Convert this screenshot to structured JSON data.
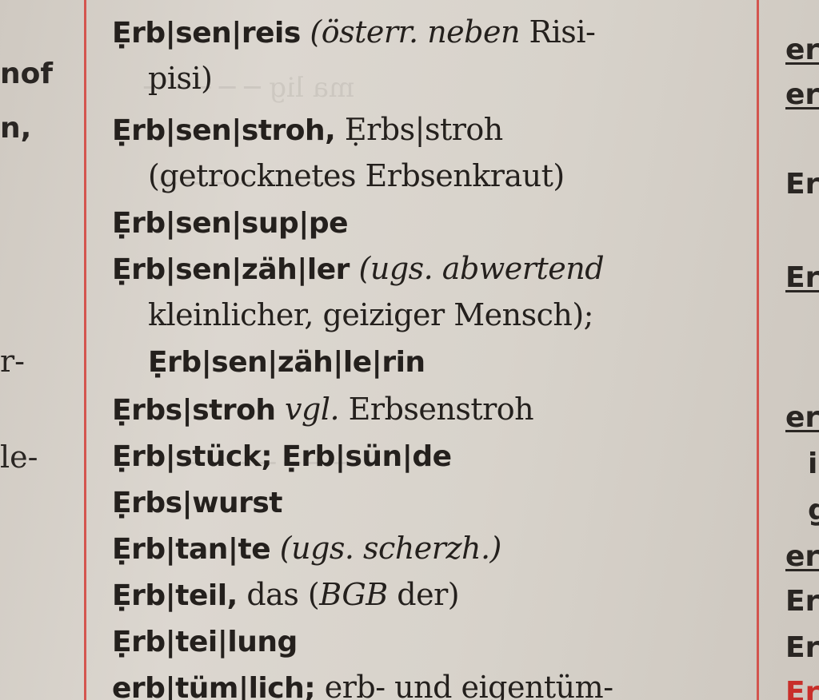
{
  "left_column": {
    "fragments": [
      {
        "text": "nof",
        "bold": true
      },
      {
        "text": "n,",
        "bold": true
      },
      {
        "text": "r-",
        "bold": false
      },
      {
        "text": "le-",
        "bold": false
      }
    ]
  },
  "right_column": {
    "fragments": [
      {
        "text": "er"
      },
      {
        "text": "er"
      },
      {
        "text": "Er"
      },
      {
        "text": "Er"
      },
      {
        "text": "er"
      },
      {
        "text": "i"
      },
      {
        "text": "g"
      },
      {
        "text": "er"
      },
      {
        "text": "Er"
      },
      {
        "text": "Er"
      },
      {
        "text": "Er"
      }
    ]
  },
  "entries": {
    "reis": {
      "headword": "Ẹrb|sen|reis",
      "note": "(österr. neben",
      "rest": "Risi-",
      "cont": "pisi)"
    },
    "stroh": {
      "headword": "Ẹrb|sen|stroh,",
      "variant": "Ẹrbs|stroh",
      "gloss": "(getrocknetes Erbsenkraut)"
    },
    "suppe": {
      "headword": "Ẹrb|sen|sup|pe"
    },
    "zaehler": {
      "headword": "Ẹrb|sen|zäh|ler",
      "note": "(ugs. abwertend",
      "gloss": "kleinlicher, geiziger Mensch);",
      "fem": "Ẹrb|sen|zäh|le|rin"
    },
    "erbsstroh": {
      "headword": "Ẹrbs|stroh",
      "ref": "vgl.",
      "target": "Erbsenstroh"
    },
    "stueck": {
      "headword": "Ẹrb|stück; Ẹrb|sün|de"
    },
    "wurst": {
      "headword": "Ẹrbs|wurst"
    },
    "tante": {
      "headword": "Ẹrb|tan|te",
      "note": "(ugs. scherzh.)"
    },
    "teil": {
      "headword": "Ẹrb|teil,",
      "pre": "das (",
      "abbr": "BGB",
      "post": "der)"
    },
    "teilung": {
      "headword": "Ẹrb|tei|lung"
    },
    "tuemlich": {
      "headword": "erb|tüm|lich;",
      "gloss": "erb- und eigentüm-"
    }
  },
  "colors": {
    "rule": "#d3403a",
    "ink": "#24201d",
    "paper": "#d8d3cb"
  }
}
